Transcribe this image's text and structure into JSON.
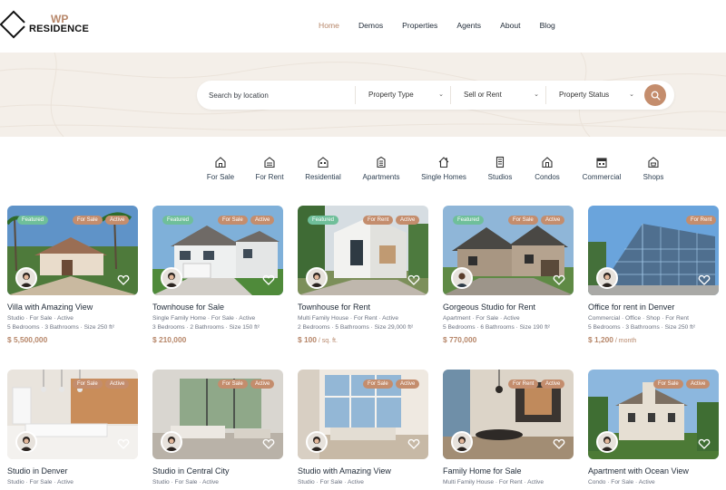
{
  "logo": {
    "line1": "WP",
    "line2": "RESIDENCE"
  },
  "nav": {
    "items": [
      {
        "label": "Home",
        "active": true
      },
      {
        "label": "Demos",
        "active": false
      },
      {
        "label": "Properties",
        "active": false
      },
      {
        "label": "Agents",
        "active": false
      },
      {
        "label": "About",
        "active": false
      },
      {
        "label": "Blog",
        "active": false
      }
    ]
  },
  "search": {
    "placeholder": "Search by location",
    "type_label": "Property Type",
    "action_label": "Sell or Rent",
    "status_label": "Property Status",
    "chevron": "⌄"
  },
  "categories": [
    {
      "label": "For Sale",
      "icon": "house-icon"
    },
    {
      "label": "For Rent",
      "icon": "house-rent-icon"
    },
    {
      "label": "Residential",
      "icon": "residential-icon"
    },
    {
      "label": "Apartments",
      "icon": "apartment-icon"
    },
    {
      "label": "Single Homes",
      "icon": "single-home-icon"
    },
    {
      "label": "Studios",
      "icon": "studio-icon"
    },
    {
      "label": "Condos",
      "icon": "condo-icon"
    },
    {
      "label": "Commercial",
      "icon": "commercial-icon"
    },
    {
      "label": "Shops",
      "icon": "shop-icon"
    }
  ],
  "colors": {
    "accent": "#c48d6d",
    "featured": "#6fbf9a",
    "band": "#f4efe9"
  },
  "listings": [
    {
      "title": "Villa with Amazing View",
      "featured": "Featured",
      "badges": [
        "For Sale",
        "Active"
      ],
      "meta": "Studio · For Sale · Active",
      "spec": "5 Bedrooms · 3 Bathrooms · Size 250 ft²",
      "price": "$ 5,500,000",
      "per": ""
    },
    {
      "title": "Townhouse for Sale",
      "featured": "Featured",
      "badges": [
        "For Sale",
        "Active"
      ],
      "meta": "Single Family Home · For Sale · Active",
      "spec": "3 Bedrooms · 2 Bathrooms · Size 150 ft²",
      "price": "$ 210,000",
      "per": ""
    },
    {
      "title": "Townhouse for Rent",
      "featured": "Featured",
      "badges": [
        "For Rent",
        "Active"
      ],
      "meta": "Multi Family House · For Rent · Active",
      "spec": "2 Bedrooms · 5 Bathrooms · Size 29,000 ft²",
      "price": "$ 100",
      "per": " / sq. ft."
    },
    {
      "title": "Gorgeous Studio for Rent",
      "featured": "Featured",
      "badges": [
        "For Sale",
        "Active"
      ],
      "meta": "Apartment · For Sale · Active",
      "spec": "5 Bedrooms · 6 Bathrooms · Size 190 ft²",
      "price": "$ 770,000",
      "per": ""
    },
    {
      "title": "Office for rent in Denver",
      "featured": "",
      "badges": [
        "For Rent"
      ],
      "meta": "Commercial · Office · Shop · For Rent",
      "spec": "5 Bedrooms · 3 Bathrooms · Size 250 ft²",
      "price": "$ 1,200",
      "per": " / month"
    },
    {
      "title": "Studio in Denver",
      "featured": "",
      "badges": [
        "For Sale",
        "Active"
      ],
      "meta": "Studio · For Sale · Active",
      "spec": "",
      "price": "",
      "per": ""
    },
    {
      "title": "Studio in Central City",
      "featured": "",
      "badges": [
        "For Sale",
        "Active"
      ],
      "meta": "Studio · For Sale · Active",
      "spec": "",
      "price": "",
      "per": ""
    },
    {
      "title": "Studio with Amazing View",
      "featured": "",
      "badges": [
        "For Sale",
        "Active"
      ],
      "meta": "Studio · For Sale · Active",
      "spec": "",
      "price": "",
      "per": ""
    },
    {
      "title": "Family Home for Sale",
      "featured": "",
      "badges": [
        "For Rent",
        "Active"
      ],
      "meta": "Multi Family House · For Rent · Active",
      "spec": "",
      "price": "",
      "per": ""
    },
    {
      "title": "Apartment with Ocean View",
      "featured": "",
      "badges": [
        "For Sale",
        "Active"
      ],
      "meta": "Condo · For Sale · Active",
      "spec": "",
      "price": "",
      "per": ""
    }
  ]
}
